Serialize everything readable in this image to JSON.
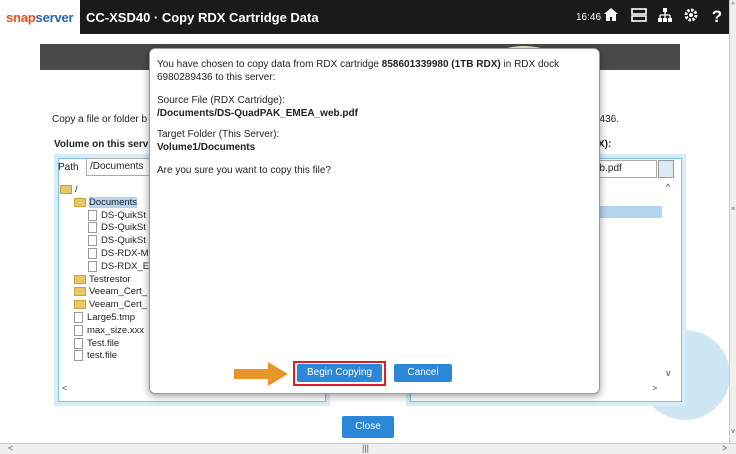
{
  "header": {
    "brand_part1": "snap",
    "brand_part2": "server",
    "title": "CC-XSD40 · Copy RDX Cartridge Data",
    "time": "16:46",
    "icons": [
      "home-icon",
      "storage-icon",
      "network-icon",
      "gear-icon",
      "help-icon"
    ]
  },
  "background": {
    "intro_prefix": "Copy a file or folder b",
    "intro_suffix": "9436.",
    "volume_left": "Volume on this serv",
    "volume_right": "X):",
    "path_label": "Path",
    "path_value": "/Documents",
    "right_field": "eb.pdf",
    "tree": [
      {
        "name": "/",
        "type": "folder",
        "indent": 0
      },
      {
        "name": "Documents",
        "type": "folder",
        "indent": 1,
        "selected": true
      },
      {
        "name": "DS-QuikSt",
        "type": "file",
        "indent": 2
      },
      {
        "name": "DS-QuikSt",
        "type": "file",
        "indent": 2
      },
      {
        "name": "DS-QuikSt",
        "type": "file",
        "indent": 2
      },
      {
        "name": "DS-RDX-M",
        "type": "file",
        "indent": 2
      },
      {
        "name": "DS-RDX_E",
        "type": "file",
        "indent": 2
      },
      {
        "name": "Testrestor",
        "type": "folder",
        "indent": 1
      },
      {
        "name": "Veeam_Cert_",
        "type": "folder",
        "indent": 1
      },
      {
        "name": "Veeam_Cert_",
        "type": "folder",
        "indent": 1
      },
      {
        "name": "Large5.tmp",
        "type": "file",
        "indent": 1
      },
      {
        "name": "max_size.xxx",
        "type": "file",
        "indent": 1
      },
      {
        "name": "Test.file",
        "type": "file",
        "indent": 1
      },
      {
        "name": "test.file",
        "type": "file",
        "indent": 1
      }
    ],
    "close_label": "Close"
  },
  "dialog": {
    "line1_a": "You have chosen to copy data from RDX cartridge ",
    "line1_b": "858601339980 (1TB RDX)",
    "line1_c": " in RDX dock 6980289436 to this server:",
    "source_label": "Source File (RDX Cartridge):",
    "source_value": "/Documents/DS-QuadPAK_EMEA_web.pdf",
    "target_label": "Target Folder (This Server):",
    "target_value": "Volume1/Documents",
    "question": "Are you sure you want to copy this file?",
    "begin_label": "Begin Copying",
    "cancel_label": "Cancel"
  },
  "colors": {
    "accent": "#2b88d8",
    "highlight": "#e31b23",
    "arrow": "#e8952a",
    "topbar": "#1a1a1a"
  }
}
